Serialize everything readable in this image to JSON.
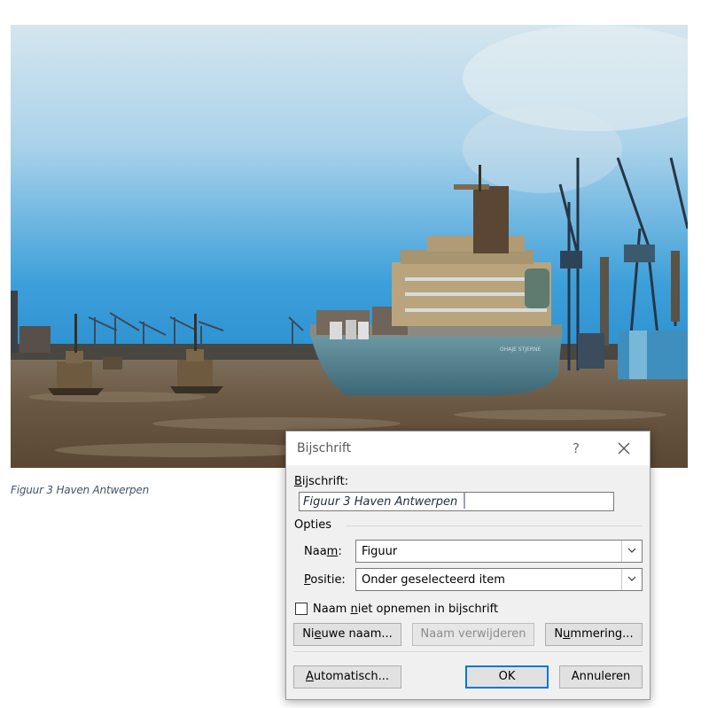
{
  "document": {
    "figure_caption": "Figuur 3 Haven Antwerpen"
  },
  "photo": {
    "ship_name": "OHAJE STJERNE",
    "colors": {
      "sky_top": "#cfe3ef",
      "sky_bottom": "#2f9ad8",
      "water": "#6b5a45",
      "hull": "#4f7d8d"
    }
  },
  "dialog": {
    "title": "Bijschrift",
    "help_label": "?",
    "caption_label": "Bijschrift:",
    "caption_value": "Figuur 3 Haven Antwerpen",
    "options_label": "Opties",
    "name_label": "Naam:",
    "name_value": "Figuur",
    "position_label": "Positie:",
    "position_value": "Onder geselecteerd item",
    "exclude_label_checkbox": "Naam niet opnemen in bijschrift",
    "exclude_checked": false,
    "buttons": {
      "new_label": "Nieuwe naam...",
      "delete_label": "Naam verwijderen",
      "numbering": "Nummering...",
      "autocaption": "Automatisch...",
      "ok": "OK",
      "cancel": "Annuleren"
    }
  }
}
